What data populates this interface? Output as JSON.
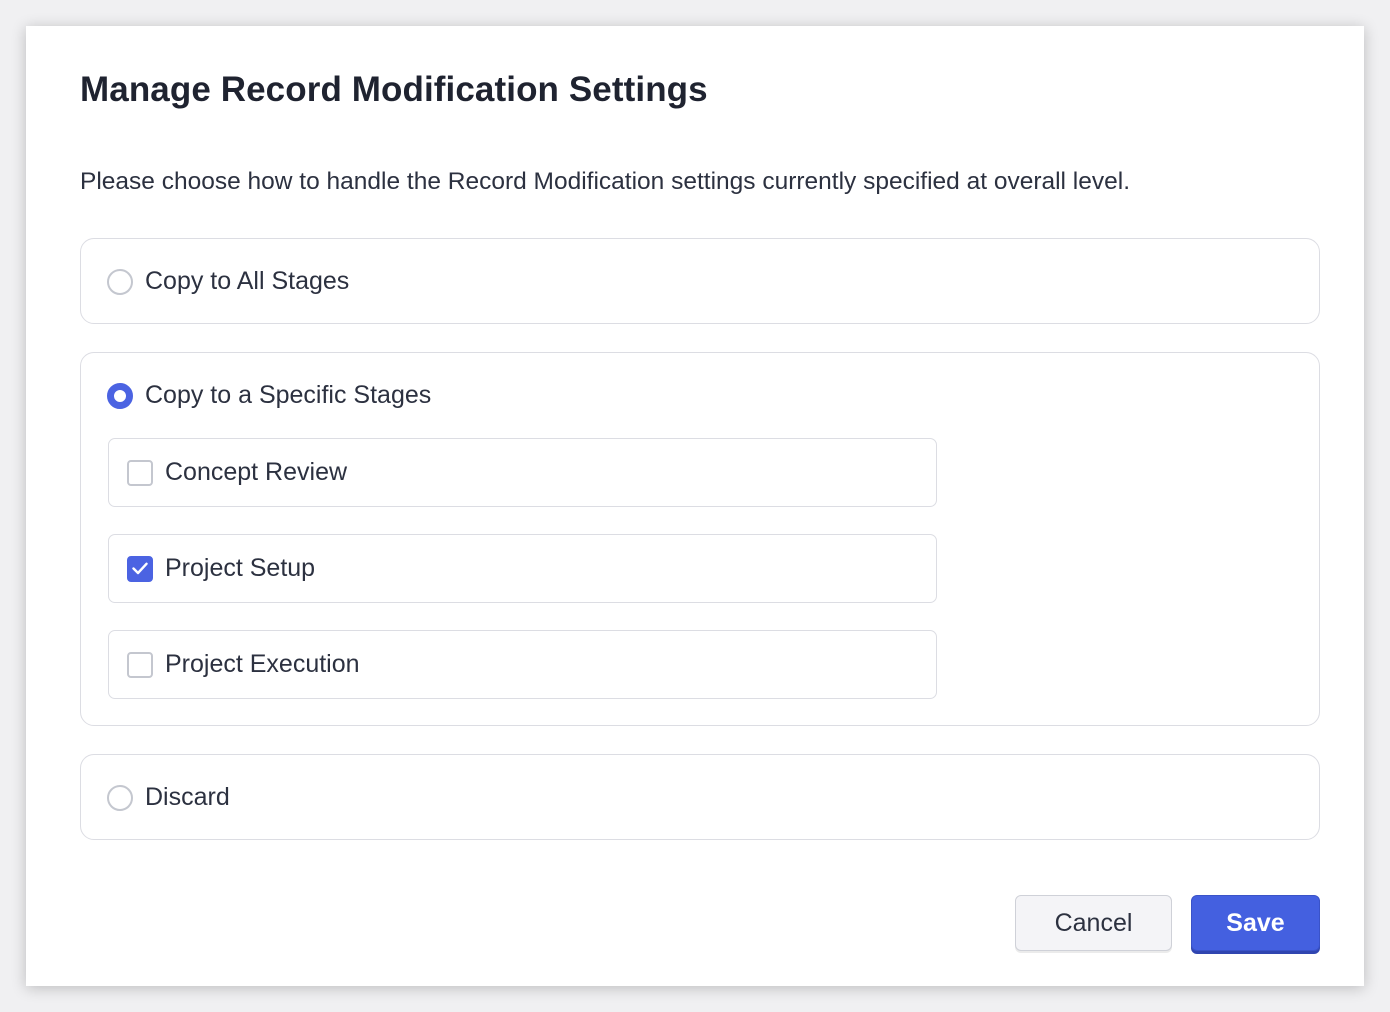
{
  "dialog": {
    "title": "Manage Record Modification Settings",
    "description": "Please choose how to handle the Record Modification settings currently specified at overall level."
  },
  "options": [
    {
      "label": "Copy to All Stages",
      "selected": false
    },
    {
      "label": "Copy to a Specific Stages",
      "selected": true
    },
    {
      "label": "Discard",
      "selected": false
    }
  ],
  "stages": [
    {
      "label": "Concept Review",
      "checked": false
    },
    {
      "label": "Project Setup",
      "checked": true
    },
    {
      "label": "Project Execution",
      "checked": false
    }
  ],
  "buttons": {
    "cancel_label": "Cancel",
    "save_label": "Save"
  },
  "colors": {
    "accent": "#4b63e2",
    "save_button": "#4460e0",
    "border": "#dcdde3"
  }
}
